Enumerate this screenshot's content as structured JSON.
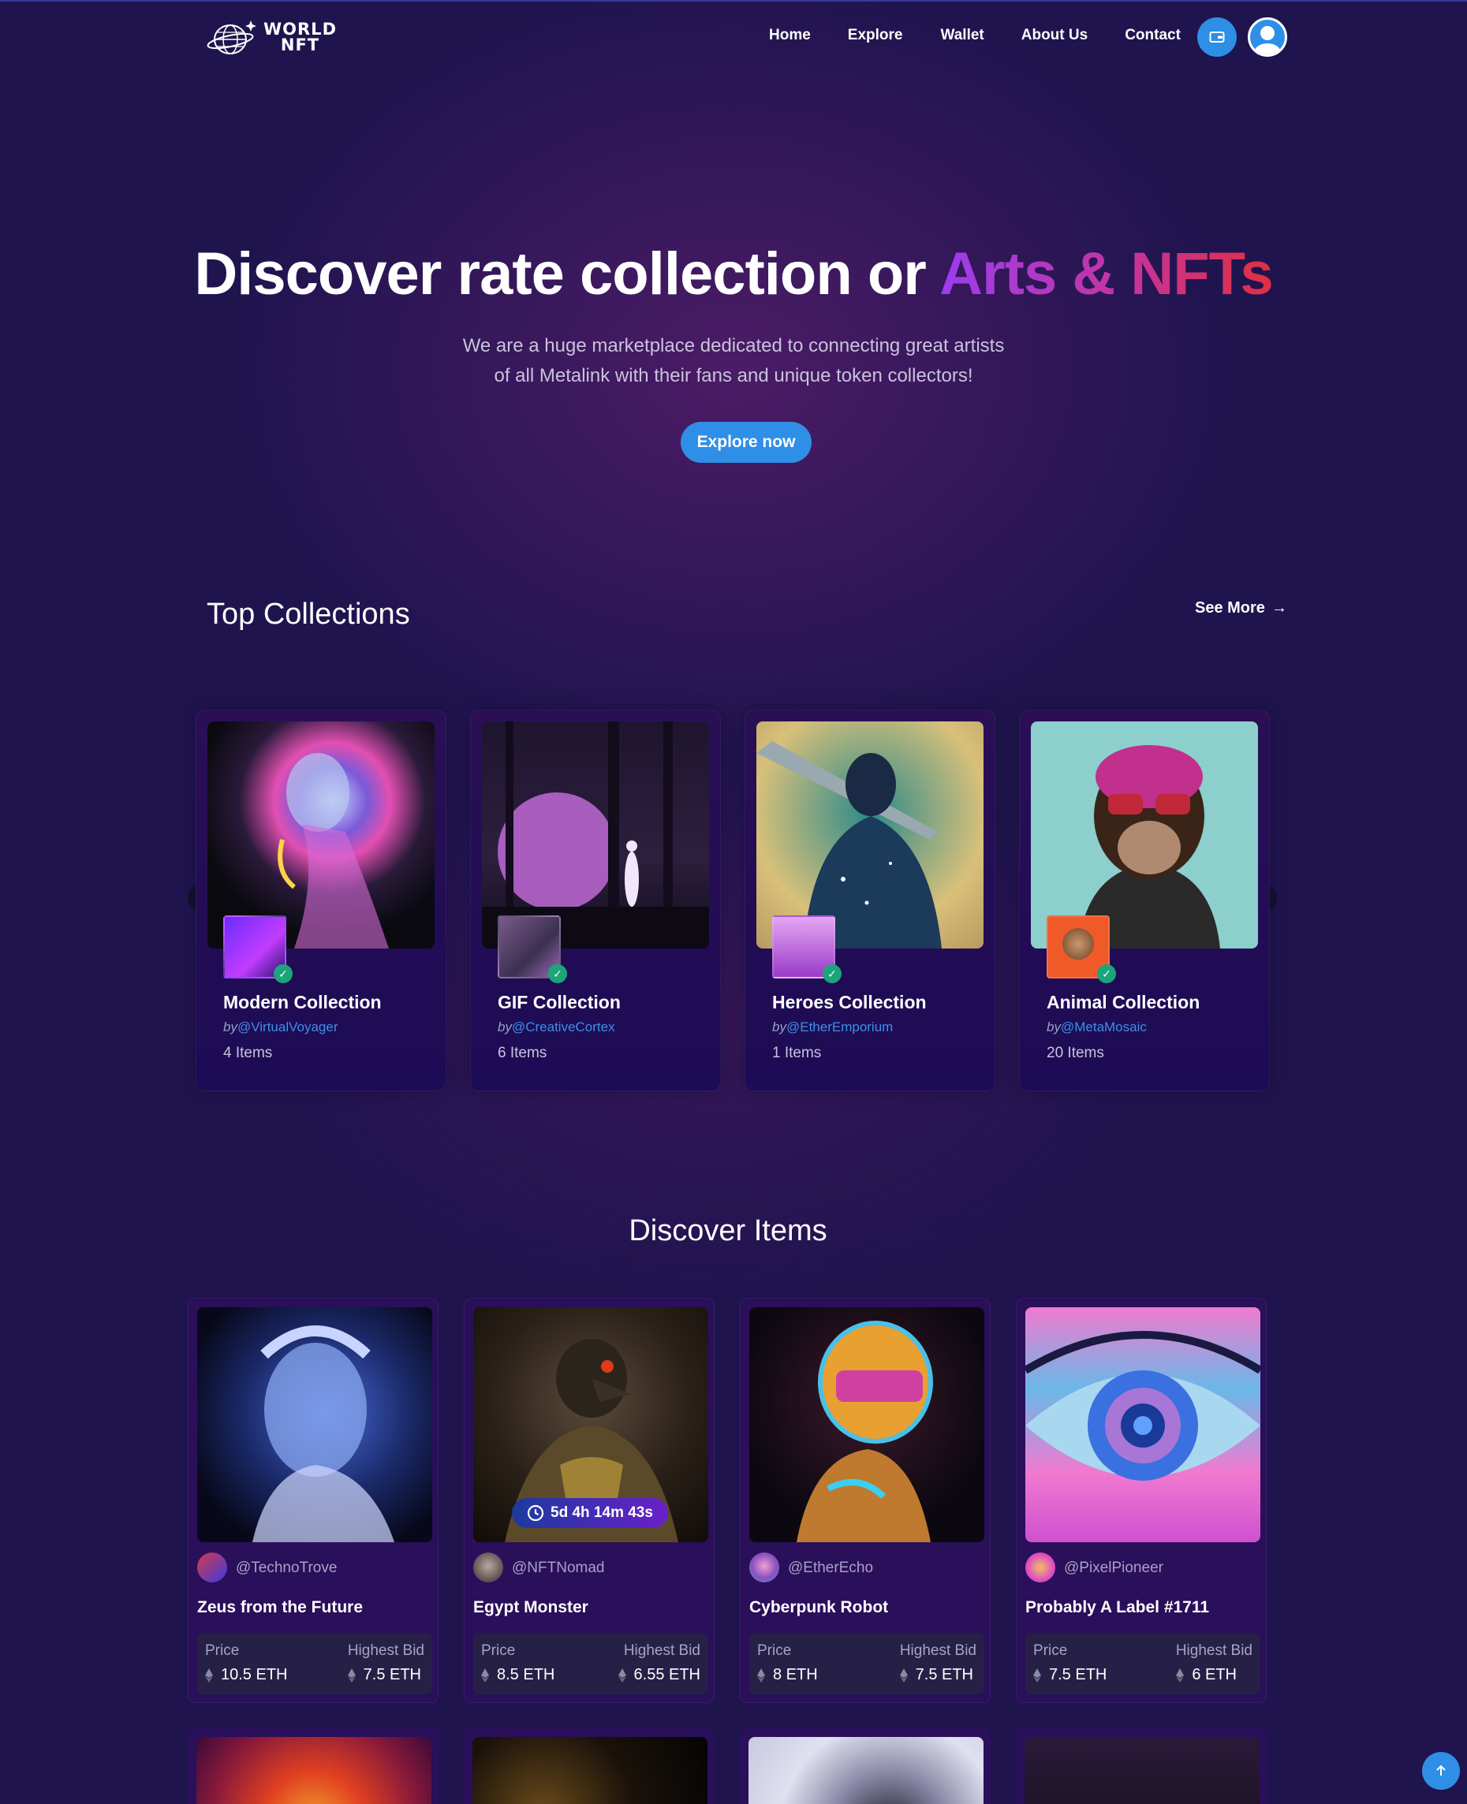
{
  "nav": {
    "logo_line1": "WORLD",
    "logo_line2": "NFT",
    "links": [
      "Home",
      "Explore",
      "Wallet",
      "About Us",
      "Contact"
    ],
    "wallet_icon": "wallet-icon",
    "avatar_icon": "user-avatar-icon"
  },
  "hero": {
    "title_plain": "Discover rate collection or ",
    "title_gradient": "Arts & NFTs",
    "subtitle_line1": "We are a huge marketplace dedicated to connecting great artists",
    "subtitle_line2": "of all Metalink with their fans and unique token collectors!",
    "cta": "Explore now"
  },
  "collections": {
    "title": "Top Collections",
    "see_more": "See More",
    "by_prefix": "by",
    "cards": [
      {
        "name": "Modern Collection",
        "handle": "@VirtualVoyager",
        "items": "4 Items"
      },
      {
        "name": "GIF Collection",
        "handle": "@CreativeCortex",
        "items": "6 Items"
      },
      {
        "name": "Heroes Collection",
        "handle": "@EtherEmporium",
        "items": "1 Items"
      },
      {
        "name": "Animal Collection",
        "handle": "@MetaMosaic",
        "items": "20 Items"
      }
    ]
  },
  "discover": {
    "title": "Discover Items",
    "price_label": "Price",
    "bid_label": "Highest Bid",
    "timer": "5d 4h 14m 43s",
    "items": [
      {
        "handle": "@TechnoTrove",
        "title": "Zeus from the Future",
        "price": "10.5 ETH",
        "bid": "7.5 ETH"
      },
      {
        "handle": "@NFTNomad",
        "title": "Egypt Monster",
        "price": "8.5 ETH",
        "bid": "6.55 ETH"
      },
      {
        "handle": "@EtherEcho",
        "title": "Cyberpunk Robot",
        "price": "8 ETH",
        "bid": "7.5 ETH"
      },
      {
        "handle": "@PixelPioneer",
        "title": "Probably A Label #1711",
        "price": "7.5 ETH",
        "bid": "6 ETH"
      }
    ]
  },
  "colors": {
    "background": "#20144f",
    "accent_blue": "#2f8fe6",
    "gradient_start": "#9b3df0",
    "gradient_end": "#e0303f",
    "verified_green": "#1aa57a"
  }
}
